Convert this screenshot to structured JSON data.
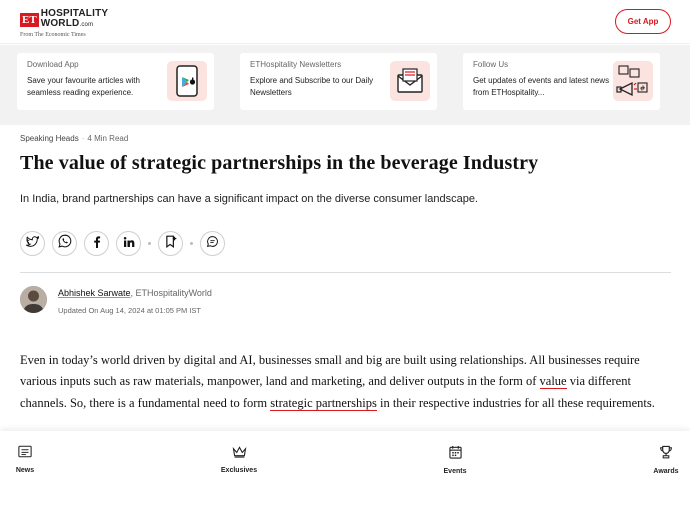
{
  "header": {
    "logo_et": "ET",
    "logo_line1": "HOSPITALITY",
    "logo_line2": "WORLD",
    "logo_com": ".com",
    "logo_sub": "From The Economic Times",
    "get_app": "Get App"
  },
  "promo": [
    {
      "title": "Download App",
      "desc": "Save your favourite articles with seamless reading experience.",
      "icon": "phone-app-icon"
    },
    {
      "title": "ETHospitality Newsletters",
      "desc": "Explore and Subscribe to our Daily Newsletters",
      "icon": "newsletter-icon"
    },
    {
      "title": "Follow Us",
      "desc": "Get updates of events and latest news from ETHospitality...",
      "icon": "social-follow-icon"
    }
  ],
  "article": {
    "category": "Speaking Heads",
    "read_time": "4 Min Read",
    "title": "The value of strategic partnerships in the beverage Industry",
    "subtitle": "In India, brand partnerships can have a significant impact on the diverse consumer landscape.",
    "author": "Abhishek Sarwate",
    "publication": ", ETHospitalityWorld",
    "updated": "Updated On Aug 14, 2024 at 01:05 PM IST",
    "body_1": "Even in today’s world driven by digital and AI, businesses small and big are built using relationships. All businesses require various inputs such as raw materials, manpower, land and marketing, and deliver outputs in the form of ",
    "link_1": "value",
    "body_2": " via different channels. So, there is a fundamental need to form ",
    "link_2": "strategic partnerships",
    "body_3": " in their respective industries for all these requirements."
  },
  "share": [
    "twitter-icon",
    "whatsapp-icon",
    "facebook-icon",
    "linkedin-icon",
    "bookmark-icon",
    "comment-icon"
  ],
  "nav": {
    "news": "News",
    "exclusives": "Exclusives",
    "events": "Events",
    "awards": "Awards"
  },
  "colors": {
    "accent": "#d71920",
    "promo_bg": "#f2f2f2",
    "icon_bg": "#fbe3df"
  }
}
